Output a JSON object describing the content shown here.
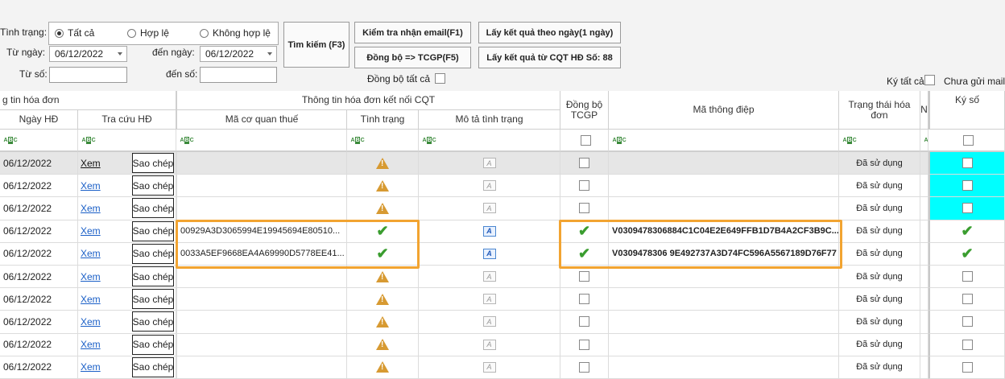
{
  "filters": {
    "status_label": "Tình trạng:",
    "radio_all": "Tất cả",
    "radio_valid": "Hợp lệ",
    "radio_invalid": "Không hợp lệ",
    "from_date_label": "Từ ngày:",
    "from_date": "06/12/2022",
    "to_date_label": "đến ngày:",
    "to_date": "06/12/2022",
    "from_no_label": "Từ số:",
    "to_no_label": "đến số:"
  },
  "buttons": {
    "search": "Tìm kiếm (F3)",
    "check_email": "Kiểm tra nhận email(F1)",
    "sync": "Đồng bộ => TCGP(F5)",
    "result_by_day": "Lấy kết quả theo ngày(1 ngày)",
    "result_by_no": "Lấy kết quả từ CQT HĐ Số: 88"
  },
  "options": {
    "sync_all": "Đồng bộ tất cả",
    "sign_all": "Ký tất cả",
    "unsent_mail": "Chưa gửi mail"
  },
  "grid": {
    "group_invoice": "g tin hóa đơn",
    "group_cqt": "Thông tin hóa đơn kết nối CQT",
    "col_date": "Ngày HĐ",
    "col_lookup": "Tra cứu HĐ",
    "col_tax_code": "Mã cơ quan thuế",
    "col_status": "Tình trạng",
    "col_status_desc": "Mô tả tình trạng",
    "col_sync": "Đồng bộ TCGP",
    "col_msg_code": "Mã thông điệp",
    "col_invoice_state": "Trạng thái hóa đơn",
    "col_n": "N",
    "col_sign": "Ký số",
    "rows": [
      {
        "date": "06/12/2022",
        "view": "Xem",
        "copy": "Sao chép",
        "tax_code": "",
        "status": "warn",
        "state": "Đã sử dụng",
        "sign": "empty",
        "msg": "",
        "sync": false,
        "linkstyle": "plain"
      },
      {
        "date": "06/12/2022",
        "view": "Xem",
        "copy": "Sao chép",
        "tax_code": "",
        "status": "warn",
        "state": "Đã sử dụng",
        "sign": "empty",
        "msg": "",
        "sync": false,
        "linkstyle": "blue"
      },
      {
        "date": "06/12/2022",
        "view": "Xem",
        "copy": "Sao chép",
        "tax_code": "",
        "status": "warn",
        "state": "Đã sử dụng",
        "sign": "empty",
        "msg": "",
        "sync": false,
        "linkstyle": "blue"
      },
      {
        "date": "06/12/2022",
        "view": "Xem",
        "copy": "Sao chép",
        "tax_code": "00929A3D3065994E19945694E80510...",
        "status": "ok",
        "state": "Đã sử dụng",
        "sign": "ok",
        "msg": "V0309478306884C1C04E2E649FFB1D7B4A2CF3B9C...",
        "sync": true,
        "linkstyle": "blue"
      },
      {
        "date": "06/12/2022",
        "view": "Xem",
        "copy": "Sao chép",
        "tax_code": "0033A5EF9668EA4A69990D5778EE41...",
        "status": "ok",
        "state": "Đã sử dụng",
        "sign": "ok",
        "msg": "V0309478306 9E492737A3D74FC596A5567189D76F77",
        "sync": true,
        "linkstyle": "blue"
      },
      {
        "date": "06/12/2022",
        "view": "Xem",
        "copy": "Sao chép",
        "tax_code": "",
        "status": "warn",
        "state": "Đã sử dụng",
        "sign": "empty",
        "msg": "",
        "sync": false,
        "linkstyle": "blue"
      },
      {
        "date": "06/12/2022",
        "view": "Xem",
        "copy": "Sao chép",
        "tax_code": "",
        "status": "warn",
        "state": "Đã sử dụng",
        "sign": "empty",
        "msg": "",
        "sync": false,
        "linkstyle": "blue"
      },
      {
        "date": "06/12/2022",
        "view": "Xem",
        "copy": "Sao chép",
        "tax_code": "",
        "status": "warn",
        "state": "Đã sử dụng",
        "sign": "empty",
        "msg": "",
        "sync": false,
        "linkstyle": "blue"
      },
      {
        "date": "06/12/2022",
        "view": "Xem",
        "copy": "Sao chép",
        "tax_code": "",
        "status": "warn",
        "state": "Đã sử dụng",
        "sign": "empty",
        "msg": "",
        "sync": false,
        "linkstyle": "blue"
      },
      {
        "date": "06/12/2022",
        "view": "Xem",
        "copy": "Sao chép",
        "tax_code": "",
        "status": "warn",
        "state": "Đã sử dụng",
        "sign": "empty",
        "msg": "",
        "sync": false,
        "linkstyle": "blue"
      }
    ]
  },
  "colors": {
    "highlight": "#f2a431",
    "sign_cell": "#00ffff",
    "link": "#1a5fc7",
    "ok": "#3a9d2f",
    "warn": "#d79a32"
  }
}
